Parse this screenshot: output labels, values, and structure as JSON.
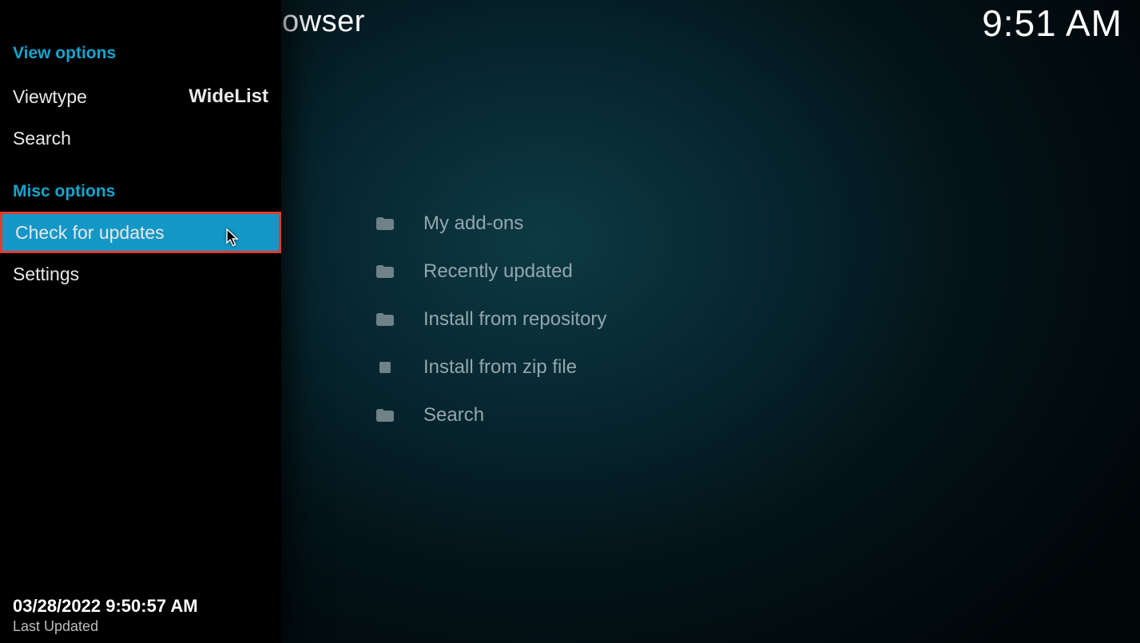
{
  "header": {
    "title_visible_fragment": "owser",
    "clock": "9:51 AM"
  },
  "panel": {
    "view_options_header": "View options",
    "viewtype_label": "Viewtype",
    "viewtype_value": "WideList",
    "search_label": "Search",
    "misc_options_header": "Misc options",
    "check_updates_label": "Check for updates",
    "settings_label": "Settings",
    "footer_timestamp": "03/28/2022 9:50:57 AM",
    "footer_caption": "Last Updated"
  },
  "main_list": {
    "items": [
      {
        "icon": "folder",
        "label": "My add-ons"
      },
      {
        "icon": "folder",
        "label": "Recently updated"
      },
      {
        "icon": "folder",
        "label": "Install from repository"
      },
      {
        "icon": "zip",
        "label": "Install from zip file"
      },
      {
        "icon": "folder",
        "label": "Search"
      }
    ]
  }
}
